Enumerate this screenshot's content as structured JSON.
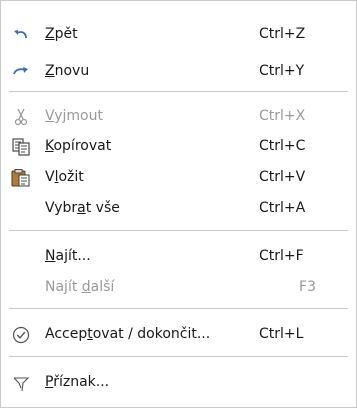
{
  "menu": {
    "items": [
      {
        "pre": "",
        "ul": "Z",
        "post": "pět",
        "shortcut": "Ctrl+Z",
        "icon": "undo-icon",
        "enabled": true
      },
      {
        "pre": "",
        "ul": "Z",
        "post": "novu",
        "shortcut": "Ctrl+Y",
        "icon": "redo-icon",
        "enabled": true
      },
      {
        "pre": "",
        "ul": "V",
        "post": "yjmout",
        "shortcut": "Ctrl+X",
        "icon": "cut-icon",
        "enabled": false
      },
      {
        "pre": "",
        "ul": "K",
        "post": "opírovat",
        "shortcut": "Ctrl+C",
        "icon": "copy-icon",
        "enabled": true
      },
      {
        "pre": "V",
        "ul": "l",
        "post": "ožit",
        "shortcut": "Ctrl+V",
        "icon": "paste-icon",
        "enabled": true
      },
      {
        "pre": "Vybr",
        "ul": "a",
        "post": "t vše",
        "shortcut": "Ctrl+A",
        "icon": "",
        "enabled": true
      },
      {
        "pre": "",
        "ul": "N",
        "post": "ajít...",
        "shortcut": "Ctrl+F",
        "icon": "",
        "enabled": true
      },
      {
        "pre": "Najít ",
        "ul": "d",
        "post": "alší",
        "shortcut": "F3",
        "icon": "",
        "enabled": false
      },
      {
        "pre": "Accep",
        "ul": "t",
        "post": "ovat / dokončit...",
        "shortcut": "Ctrl+L",
        "icon": "check-circle-icon",
        "enabled": true
      },
      {
        "pre": "",
        "ul": "P",
        "post": "říznak...",
        "shortcut": "",
        "icon": "flag-icon",
        "enabled": true
      }
    ]
  }
}
